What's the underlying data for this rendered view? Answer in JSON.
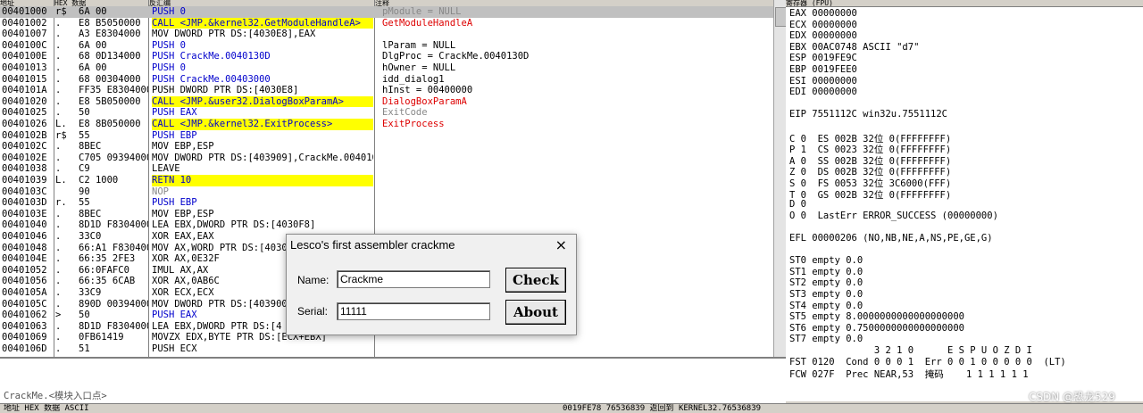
{
  "cpu_headers": {
    "addr": "地址",
    "hex": "HEX 数据",
    "dis": "反汇编",
    "cmt": "注释"
  },
  "disasm_rows": [
    {
      "addr": "00401000",
      "mk": "r$",
      "hex": "6A 00",
      "dis": "PUSH 0",
      "cmt": "pModule = NULL",
      "sel": true
    },
    {
      "addr": "00401002",
      "mk": ".",
      "hex": "E8 B5050000",
      "dis": "CALL <JMP.&kernel32.GetModuleHandleA>",
      "cmt": "GetModuleHandleA"
    },
    {
      "addr": "00401007",
      "mk": ".",
      "hex": "A3 E8304000",
      "dis": "MOV DWORD PTR DS:[4030E8],EAX",
      "cmt": ""
    },
    {
      "addr": "0040100C",
      "mk": ".",
      "hex": "6A 00",
      "dis": "PUSH 0",
      "cmt": "lParam = NULL"
    },
    {
      "addr": "0040100E",
      "mk": ".",
      "hex": "68 0D134000",
      "dis": "PUSH CrackMe.0040130D",
      "cmt": "DlgProc = CrackMe.0040130D"
    },
    {
      "addr": "00401013",
      "mk": ".",
      "hex": "6A 00",
      "dis": "PUSH 0",
      "cmt": "hOwner = NULL"
    },
    {
      "addr": "00401015",
      "mk": ".",
      "hex": "68 00304000",
      "dis": "PUSH CrackMe.00403000",
      "cmt": "idd_dialog1"
    },
    {
      "addr": "0040101A",
      "mk": ".",
      "hex": "FF35 E8304000",
      "dis": "PUSH DWORD PTR DS:[4030E8]",
      "cmt": "hInst = 00400000"
    },
    {
      "addr": "00401020",
      "mk": ".",
      "hex": "E8 5B050000",
      "dis": "CALL <JMP.&user32.DialogBoxParamA>",
      "cmt": "DialogBoxParamA"
    },
    {
      "addr": "00401025",
      "mk": ".",
      "hex": "50",
      "dis": "PUSH EAX",
      "cmt": "ExitCode"
    },
    {
      "addr": "00401026",
      "mk": "L.",
      "hex": "E8 8B050000",
      "dis": "CALL <JMP.&kernel32.ExitProcess>",
      "cmt": "ExitProcess"
    },
    {
      "addr": "0040102B",
      "mk": "r$",
      "hex": "55",
      "dis": "PUSH EBP",
      "cmt": ""
    },
    {
      "addr": "0040102C",
      "mk": ".",
      "hex": "8BEC",
      "dis": "MOV EBP,ESP",
      "cmt": ""
    },
    {
      "addr": "0040102E",
      "mk": ".",
      "hex": "C705 09394000",
      "dis": "MOV DWORD PTR DS:[403909],CrackMe.004010",
      "cmt": ""
    },
    {
      "addr": "00401038",
      "mk": ".",
      "hex": "C9",
      "dis": "LEAVE",
      "cmt": ""
    },
    {
      "addr": "00401039",
      "mk": "L.",
      "hex": "C2 1000",
      "dis": "RETN 10",
      "cmt": ""
    },
    {
      "addr": "0040103C",
      "mk": "",
      "hex": "90",
      "dis": "NOP",
      "cmt": ""
    },
    {
      "addr": "0040103D",
      "mk": "r.",
      "hex": "55",
      "dis": "PUSH EBP",
      "cmt": ""
    },
    {
      "addr": "0040103E",
      "mk": ".",
      "hex": "8BEC",
      "dis": "MOV EBP,ESP",
      "cmt": ""
    },
    {
      "addr": "00401040",
      "mk": ".",
      "hex": "8D1D F8304000",
      "dis": "LEA EBX,DWORD PTR DS:[4030F8]",
      "cmt": ""
    },
    {
      "addr": "00401046",
      "mk": ".",
      "hex": "33C0",
      "dis": "XOR EAX,EAX",
      "cmt": ""
    },
    {
      "addr": "00401048",
      "mk": ".",
      "hex": "66:A1 F8304000",
      "dis": "MOV AX,WORD PTR DS:[4030",
      "cmt": ""
    },
    {
      "addr": "0040104E",
      "mk": ".",
      "hex": "66:35 2FE3",
      "dis": "XOR AX,0E32F",
      "cmt": ""
    },
    {
      "addr": "00401052",
      "mk": ".",
      "hex": "66:0FAFC0",
      "dis": "IMUL AX,AX",
      "cmt": ""
    },
    {
      "addr": "00401056",
      "mk": ".",
      "hex": "66:35 6CAB",
      "dis": "XOR AX,0AB6C",
      "cmt": ""
    },
    {
      "addr": "0040105A",
      "mk": ".",
      "hex": "33C9",
      "dis": "XOR ECX,ECX",
      "cmt": ""
    },
    {
      "addr": "0040105C",
      "mk": ".",
      "hex": "890D 00394000",
      "dis": "MOV DWORD PTR DS:[403900",
      "cmt": ""
    },
    {
      "addr": "00401062",
      "mk": ">",
      "hex": "50",
      "dis": "PUSH EAX",
      "cmt": ""
    },
    {
      "addr": "00401063",
      "mk": ".",
      "hex": "8D1D F8304000",
      "dis": "LEA EBX,DWORD PTR DS:[4",
      "cmt": ""
    },
    {
      "addr": "00401069",
      "mk": ".",
      "hex": "0FB61419",
      "dis": "MOVZX EDX,BYTE PTR DS:[ECX+EBX]",
      "cmt": ""
    },
    {
      "addr": "0040106D",
      "mk": ".",
      "hex": "51",
      "dis": "PUSH ECX",
      "cmt": ""
    }
  ],
  "info_pane": {
    "text": "CrackMe.<模块入口点>"
  },
  "registers": {
    "header": "寄存器 (FPU)",
    "lines": [
      "EAX 00000000",
      "ECX 00000000",
      "EDX 00000000",
      "EBX 00AC0748 ASCII \"d7\"",
      "ESP 0019FE9C",
      "EBP 0019FEE0",
      "ESI 00000000",
      "EDI 00000000",
      "",
      "EIP 7551112C win32u.7551112C",
      "",
      "C 0  ES 002B 32位 0(FFFFFFFF)",
      "P 1  CS 0023 32位 0(FFFFFFFF)",
      "A 0  SS 002B 32位 0(FFFFFFFF)",
      "Z 0  DS 002B 32位 0(FFFFFFFF)",
      "S 0  FS 0053 32位 3C6000(FFF)",
      "T 0  GS 002B 32位 0(FFFFFFFF)",
      "D 0",
      "O 0  LastErr ERROR_SUCCESS (00000000)",
      "",
      "EFL 00000206 (NO,NB,NE,A,NS,PE,GE,G)",
      "",
      "ST0 empty 0.0",
      "ST1 empty 0.0",
      "ST2 empty 0.0",
      "ST3 empty 0.0",
      "ST4 empty 0.0",
      "ST5 empty 8.0000000000000000000",
      "ST6 empty 0.7500000000000000000",
      "ST7 empty 0.0",
      "               3 2 1 0      E S P U O Z D I",
      "FST 0120  Cond 0 0 0 1  Err 0 0 1 0 0 0 0 0  (LT)",
      "FCW 027F  Prec NEAR,53  掩码    1 1 1 1 1 1"
    ]
  },
  "bottom_bar": {
    "dump_hdr": "地址     HEX 数据                    ASCII",
    "stack": "0019FE78  76536839  返回到 KERNEL32.76536839"
  },
  "watermark": "CSDN @恐龙529",
  "dialog": {
    "title": "Lesco's first assembler crackme",
    "close": "×",
    "name_label": "Name:",
    "name_value": "Crackme",
    "serial_label": "Serial:",
    "serial_value": "11111",
    "check_label": "Check",
    "about_label": "About"
  }
}
